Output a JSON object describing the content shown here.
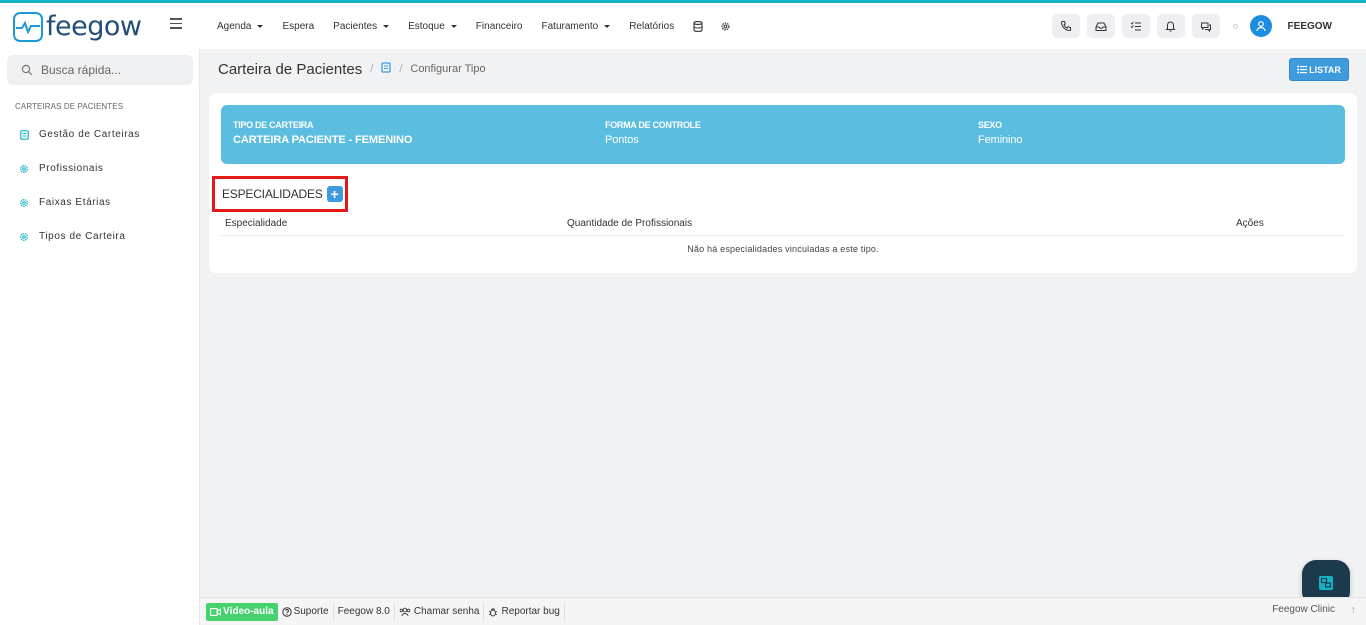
{
  "app": {
    "logo_text": "feegow",
    "accent_color": "#16b3c6"
  },
  "nav": {
    "items": [
      {
        "label": "Agenda",
        "dropdown": true
      },
      {
        "label": "Espera",
        "dropdown": false
      },
      {
        "label": "Pacientes",
        "dropdown": true
      },
      {
        "label": "Estoque",
        "dropdown": true
      },
      {
        "label": "Financeiro",
        "dropdown": false
      },
      {
        "label": "Faturamento",
        "dropdown": true
      },
      {
        "label": "Relatórios",
        "dropdown": false
      }
    ],
    "icons": [
      "database-icon",
      "gear-icon"
    ]
  },
  "header_right": {
    "buttons": [
      "phone-icon",
      "inbox-icon",
      "checklist-icon",
      "bell-icon",
      "chat-icon"
    ],
    "user_name": "FEEGOW"
  },
  "sidebar": {
    "search_placeholder": "Busca rápida...",
    "section_title": "CARTEIRAS DE PACIENTES",
    "items": [
      {
        "label": "Gestão de Carteiras",
        "icon": "book-icon"
      },
      {
        "label": "Profissionais",
        "icon": "gear-icon"
      },
      {
        "label": "Faixas Etárias",
        "icon": "gear-icon"
      },
      {
        "label": "Tipos de Carteira",
        "icon": "gear-icon"
      }
    ]
  },
  "breadcrumb": {
    "title": "Carteira de Pacientes",
    "separator": "/",
    "current": "Configurar Tipo"
  },
  "toolbar": {
    "listar_label": "LISTAR"
  },
  "info": {
    "tipo_label": "TIPO DE CARTEIRA",
    "tipo_value": "CARTEIRA PACIENTE - FEMENINO",
    "forma_label": "FORMA DE CONTROLE",
    "forma_value": "Pontos",
    "sexo_label": "SEXO",
    "sexo_value": "Feminino"
  },
  "especialidades": {
    "title": "ESPECIALIDADES",
    "add_label": "+",
    "columns": [
      "Especialidade",
      "Quantidade de Profissionais",
      "Ações"
    ],
    "empty_message": "Não há especialidades vinculadas a este tipo."
  },
  "footer": {
    "video_label": "Vídeo-aula",
    "suporte_label": "Suporte",
    "version_label": "Feegow 8.0",
    "chamar_label": "Chamar senha",
    "bug_label": "Reportar bug",
    "brand_label": "Feegow Clinic",
    "up_label": "↑"
  }
}
